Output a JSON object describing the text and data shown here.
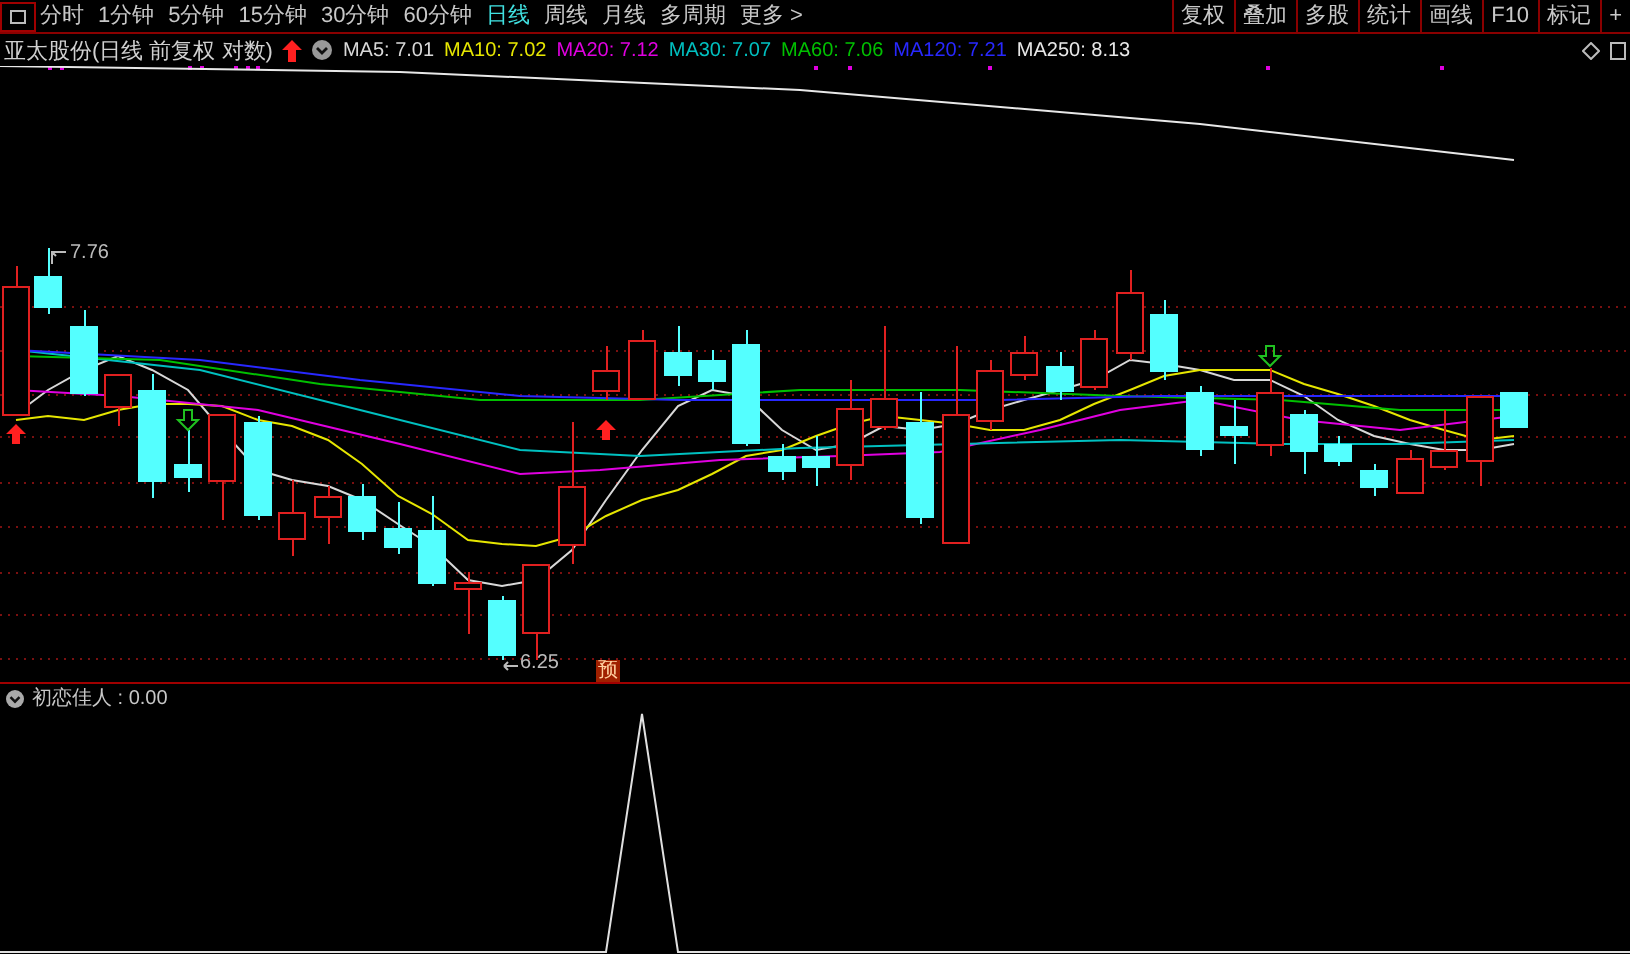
{
  "toolbar": {
    "periods": [
      {
        "label": "分时",
        "selected": false
      },
      {
        "label": "1分钟",
        "selected": false
      },
      {
        "label": "5分钟",
        "selected": false
      },
      {
        "label": "15分钟",
        "selected": false
      },
      {
        "label": "30分钟",
        "selected": false
      },
      {
        "label": "60分钟",
        "selected": false
      },
      {
        "label": "日线",
        "selected": true
      },
      {
        "label": "周线",
        "selected": false
      },
      {
        "label": "月线",
        "selected": false
      },
      {
        "label": "多周期",
        "selected": false
      }
    ],
    "more": "更多 >",
    "buttons": [
      "复权",
      "叠加",
      "多股",
      "统计",
      "画线",
      "F10",
      "标记",
      "+"
    ]
  },
  "legend": {
    "title": "亚太股份(日线 前复权 对数)",
    "averages": [
      {
        "label": "MA5: 7.01",
        "color": "#d8d8d8"
      },
      {
        "label": "MA10: 7.02",
        "color": "#e6e600"
      },
      {
        "label": "MA20: 7.12",
        "color": "#e000e0"
      },
      {
        "label": "MA30: 7.07",
        "color": "#00c0c0"
      },
      {
        "label": "MA60: 7.06",
        "color": "#00c000"
      },
      {
        "label": "MA120: 7.21",
        "color": "#2828ff"
      },
      {
        "label": "MA250: 8.13",
        "color": "#e8e8e8"
      }
    ]
  },
  "chart": {
    "high_label": "7.76",
    "low_label": "6.25",
    "marker": "预"
  },
  "indicator": {
    "label": "初恋佳人 : 0.00"
  }
}
